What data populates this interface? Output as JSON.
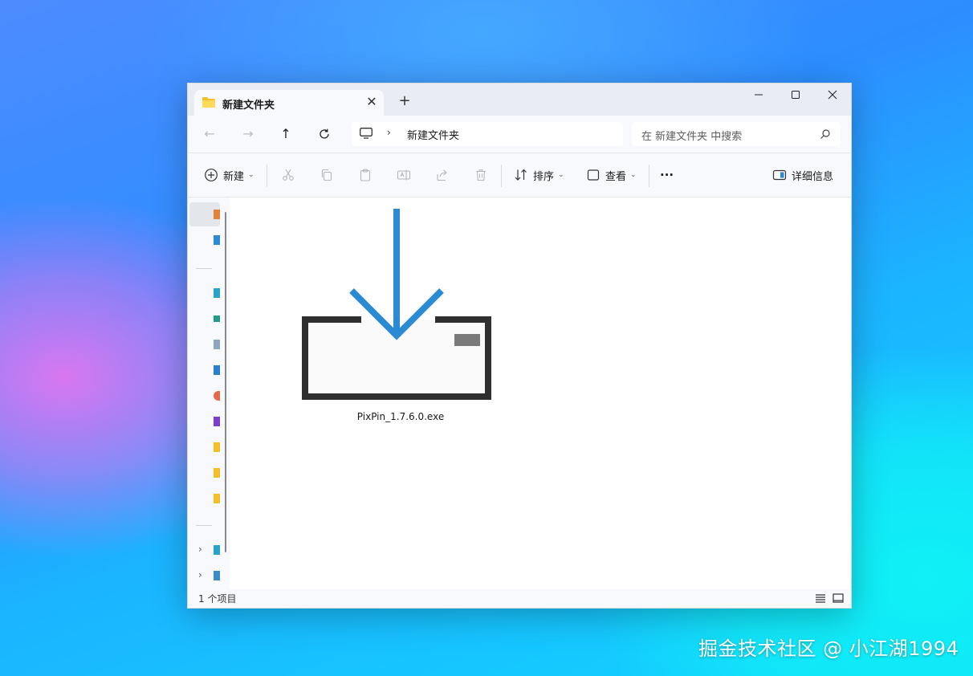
{
  "window": {
    "tab_title": "新建文件夹",
    "tab_close_icon": "close-icon",
    "new_tab_icon": "plus-icon"
  },
  "controls": {
    "minimize": "minimize-icon",
    "maximize": "maximize-icon",
    "close": "close-icon"
  },
  "address": {
    "breadcrumb": "新建文件夹",
    "search_placeholder": "在 新建文件夹 中搜索"
  },
  "toolbar": {
    "new_label": "新建",
    "sort_label": "排序",
    "view_label": "查看",
    "more_label": "···",
    "details_label": "详细信息"
  },
  "content": {
    "files": [
      {
        "name": "PixPin_1.7.6.0.exe",
        "icon": "installer-download-icon"
      }
    ]
  },
  "status": {
    "item_count": "1 个项目"
  },
  "watermark": "掘金技术社区 @ 小江湖1994",
  "colors": {
    "accent_blue": "#2a8ad2",
    "icon_dark": "#2f2f2f",
    "folder_yellow": "#f3c02b"
  }
}
